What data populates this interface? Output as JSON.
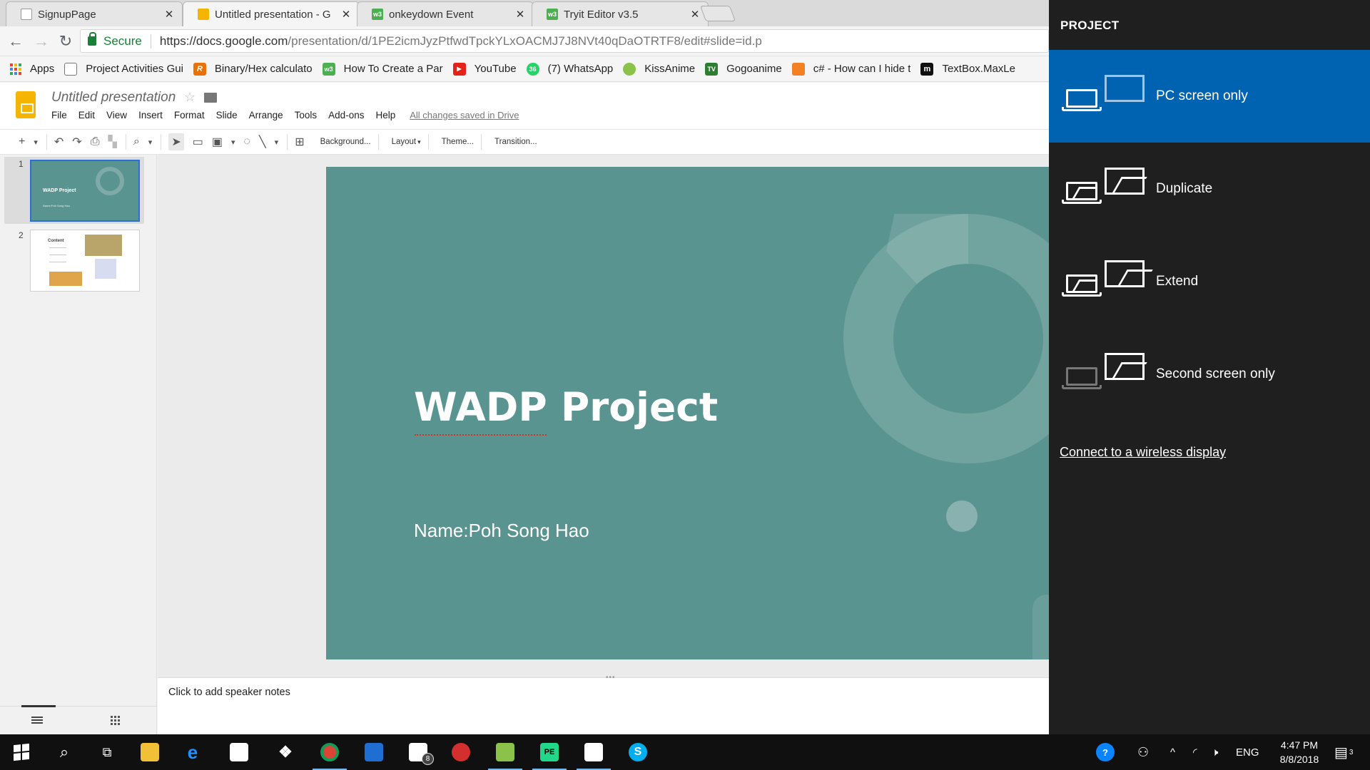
{
  "browser": {
    "tabs": [
      {
        "title": "SignupPage",
        "favicon": "document-icon",
        "active": false
      },
      {
        "title": "Untitled presentation - G",
        "favicon": "google-slides-icon",
        "active": true
      },
      {
        "title": "onkeydown Event",
        "favicon": "w3schools-icon",
        "active": false
      },
      {
        "title": "Tryit Editor v3.5",
        "favicon": "w3schools-icon",
        "active": false
      }
    ],
    "tab_close": "✕",
    "secure_label": "Secure",
    "url_host": "https://docs.google.com",
    "url_path": "/presentation/d/1PE2icmJyzPtfwdTpckYLxOACMJ7J8NVt40qDaOTRTF8/edit#slide=id.p",
    "bookmarks": [
      {
        "label": "Apps"
      },
      {
        "label": "Project Activities Gui"
      },
      {
        "label": "Binary/Hex calculato"
      },
      {
        "label": "How To Create a Par"
      },
      {
        "label": "YouTube"
      },
      {
        "label": "(7) WhatsApp"
      },
      {
        "label": "KissAnime"
      },
      {
        "label": "Gogoanime"
      },
      {
        "label": "c# - How can I hide t"
      },
      {
        "label": "TextBox.MaxLe"
      }
    ]
  },
  "slides_app": {
    "doc_title": "Untitled presentation",
    "menu": [
      "File",
      "Edit",
      "View",
      "Insert",
      "Format",
      "Slide",
      "Arrange",
      "Tools",
      "Add-ons",
      "Help"
    ],
    "save_status": "All changes saved in Drive",
    "toolbar": {
      "background": "Background...",
      "layout": "Layout",
      "theme": "Theme...",
      "transition": "Transition..."
    },
    "filmstrip": [
      {
        "number": "1",
        "title": "WADP Project",
        "subtitle": "Name:Poh Song Hao"
      },
      {
        "number": "2",
        "title": "Content"
      }
    ],
    "slide": {
      "title": "WADP Project",
      "subtitle": "Name:Poh Song Hao",
      "background_color": "#5a9490"
    },
    "speaker_notes_placeholder": "Click to add speaker notes"
  },
  "project_panel": {
    "heading": "PROJECT",
    "options": [
      {
        "label": "PC screen only",
        "selected": true
      },
      {
        "label": "Duplicate",
        "selected": false
      },
      {
        "label": "Extend",
        "selected": false
      },
      {
        "label": "Second screen only",
        "selected": false
      }
    ],
    "wireless_link": "Connect to a wireless display",
    "selected_color": "#0063b1"
  },
  "taskbar": {
    "mail_badge": "8",
    "language": "ENG",
    "time": "4:47 PM",
    "date": "8/8/2018",
    "notification_count": "3"
  }
}
